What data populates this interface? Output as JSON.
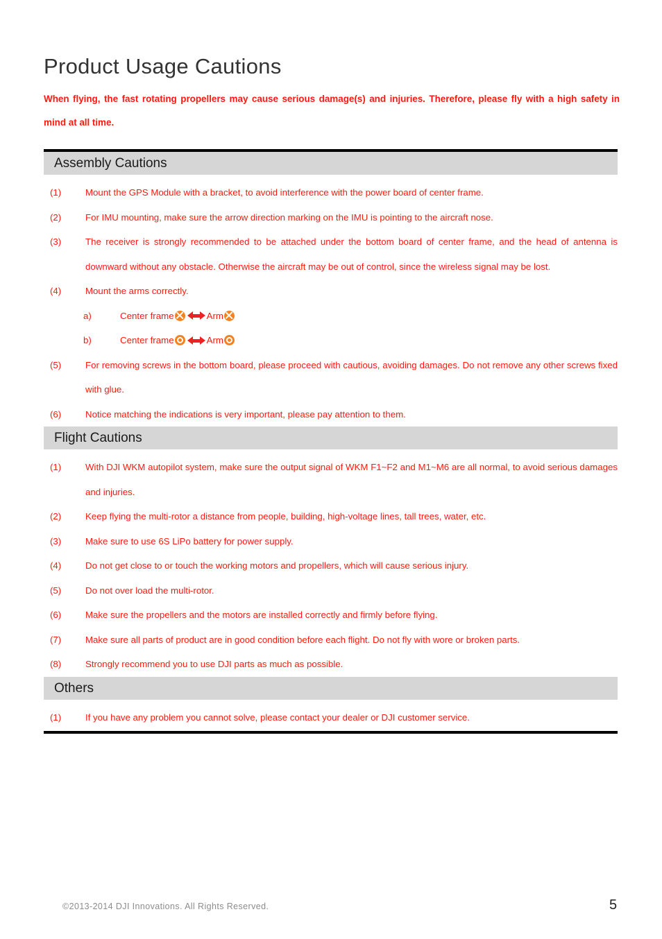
{
  "document": {
    "title": "Product Usage Cautions",
    "intro_warning": "When flying, the fast rotating propellers may cause serious damage(s) and injuries. Therefore, please fly with a high safety in mind at all time."
  },
  "sections": {
    "assembly": {
      "header": "Assembly Cautions",
      "items": [
        {
          "marker": "(1)",
          "text": "Mount the GPS Module with a bracket, to avoid interference with the power board of center frame."
        },
        {
          "marker": "(2)",
          "text": "For IMU mounting, make sure the arrow direction marking on the IMU is pointing to the aircraft nose."
        },
        {
          "marker": "(3)",
          "text": "The receiver is strongly recommended to be attached under the bottom board of center frame, and the head of antenna is downward without any obstacle. Otherwise the aircraft may be out of control, since the wireless signal may be lost."
        },
        {
          "marker": "(4)",
          "text": "Mount the arms correctly."
        },
        {
          "marker": "(5)",
          "text": "For removing screws in the bottom board, please proceed with cautious, avoiding damages. Do not remove any other screws fixed with glue."
        },
        {
          "marker": "(6)",
          "text": "Notice matching the indications is very important, please pay attention to them."
        }
      ],
      "subitems": [
        {
          "marker": "a)",
          "left_label": "Center frame",
          "left_icon": "circle-cross-icon",
          "right_label": "Arm",
          "right_icon": "circle-cross-icon"
        },
        {
          "marker": "b)",
          "left_label": "Center frame",
          "left_icon": "circle-ring-icon",
          "right_label": "Arm",
          "right_icon": "circle-ring-icon"
        }
      ]
    },
    "flight": {
      "header": "Flight Cautions",
      "items": [
        {
          "marker": "(1)",
          "text": "With DJI WKM autopilot system, make sure the output signal of WKM F1~F2 and M1~M6 are all normal, to avoid serious damages and injuries."
        },
        {
          "marker": "(2)",
          "text": "Keep flying the multi-rotor a distance from people, building, high-voltage lines, tall trees, water, etc."
        },
        {
          "marker": "(3)",
          "text": "Make sure to use 6S LiPo battery for power supply."
        },
        {
          "marker": "(4)",
          "text": "Do not get close to or touch the working motors and propellers, which will cause serious injury."
        },
        {
          "marker": "(5)",
          "text": "Do not over load the multi-rotor."
        },
        {
          "marker": "(6)",
          "text": "Make sure the propellers and the motors are installed correctly and firmly before flying."
        },
        {
          "marker": "(7)",
          "text": "Make sure all parts of product are in good condition before each flight. Do not fly with wore or broken parts."
        },
        {
          "marker": "(8)",
          "text": "Strongly recommend you to use DJI parts as much as possible."
        }
      ]
    },
    "others": {
      "header": "Others",
      "items": [
        {
          "marker": "(1)",
          "text": "If you have any problem you cannot solve, please contact your dealer or DJI customer service."
        }
      ]
    }
  },
  "footer": {
    "copyright": "©2013-2014 DJI Innovations. All Rights Reserved.",
    "page_number": "5"
  },
  "colors": {
    "body_text_red": "#ff1a10",
    "section_header_bg": "#d6d6d6",
    "title_dark": "#333333",
    "icon_orange": "#f58220",
    "arrow_red": "#ee2222",
    "footer_gray": "#8c8c8c"
  }
}
